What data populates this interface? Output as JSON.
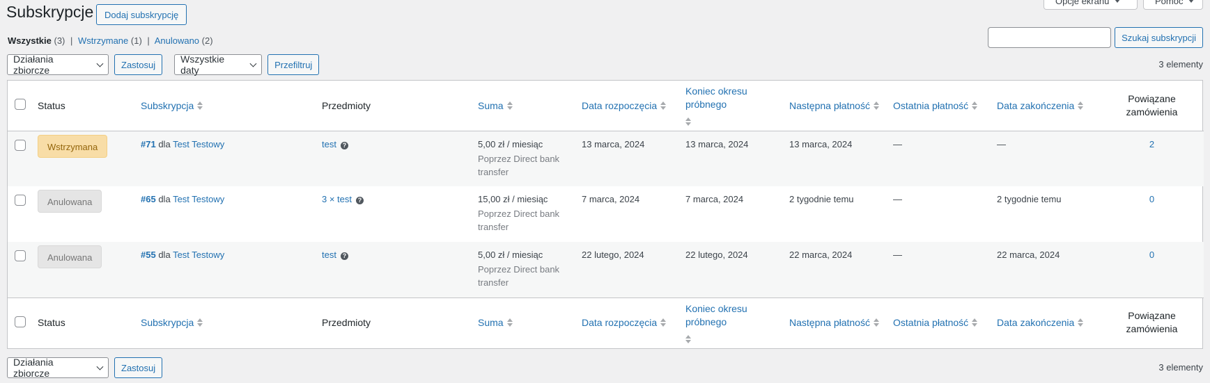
{
  "header": {
    "title": "Subskrypcje",
    "add_button": "Dodaj subskrypcję",
    "screen_options": "Opcje ekranu",
    "help": "Pomoc"
  },
  "views": [
    {
      "label": "Wszystkie",
      "count": "(3)"
    },
    {
      "label": "Wstrzymane",
      "count": "(1)"
    },
    {
      "label": "Anulowano",
      "count": "(2)"
    }
  ],
  "search": {
    "value": "",
    "button": "Szukaj subskrypcji"
  },
  "tablenav_top": {
    "bulk_select": "Działania zbiorcze",
    "apply": "Zastosuj",
    "date_select": "Wszystkie daty",
    "filter": "Przefiltruj",
    "count": "3 elementy"
  },
  "tablenav_bottom": {
    "bulk_select": "Działania zbiorcze",
    "apply": "Zastosuj",
    "count": "3 elementy"
  },
  "columns": {
    "status": "Status",
    "subscription": "Subskrypcja",
    "items": "Przedmioty",
    "total": "Suma",
    "start_date": "Data rozpoczęcia",
    "trial_end_1": "Koniec okresu",
    "trial_end_2": "próbnego",
    "next_payment": "Następna płatność",
    "last_payment": "Ostatnia płatność",
    "end_date": "Data zakończenia",
    "orders_1": "Powiązane",
    "orders_2": "zamówienia"
  },
  "rows": [
    {
      "status": "Wstrzymana",
      "order_no": "#71",
      "for": "dla",
      "customer": "Test Testowy",
      "items": "test",
      "total": "5,00 zł / miesiąc",
      "via": "Poprzez Direct bank transfer",
      "start_date": "13 marca, 2024",
      "trial_end": "13 marca, 2024",
      "next_payment": "13 marca, 2024",
      "last_payment": "—",
      "end_date": "—",
      "orders": "2"
    },
    {
      "status": "Anulowana",
      "order_no": "#65",
      "for": "dla",
      "customer": "Test Testowy",
      "items": "3 × test",
      "total": "15,00 zł / miesiąc",
      "via": "Poprzez Direct bank transfer",
      "start_date": "7 marca, 2024",
      "trial_end": "7 marca, 2024",
      "next_payment": "2 tygodnie temu",
      "last_payment": "—",
      "end_date": "2 tygodnie temu",
      "orders": "0"
    },
    {
      "status": "Anulowana",
      "order_no": "#55",
      "for": "dla",
      "customer": "Test Testowy",
      "items": "test",
      "total": "5,00 zł / miesiąc",
      "via": "Poprzez Direct bank transfer",
      "start_date": "22 lutego, 2024",
      "trial_end": "22 lutego, 2024",
      "next_payment": "22 marca, 2024",
      "last_payment": "—",
      "end_date": "22 marca, 2024",
      "orders": "0"
    }
  ],
  "colors": {
    "link": "#2271b1",
    "on_hold_bg": "#f8dda7",
    "cancelled_bg": "#e5e5e5",
    "background": "#f0f0f1"
  }
}
